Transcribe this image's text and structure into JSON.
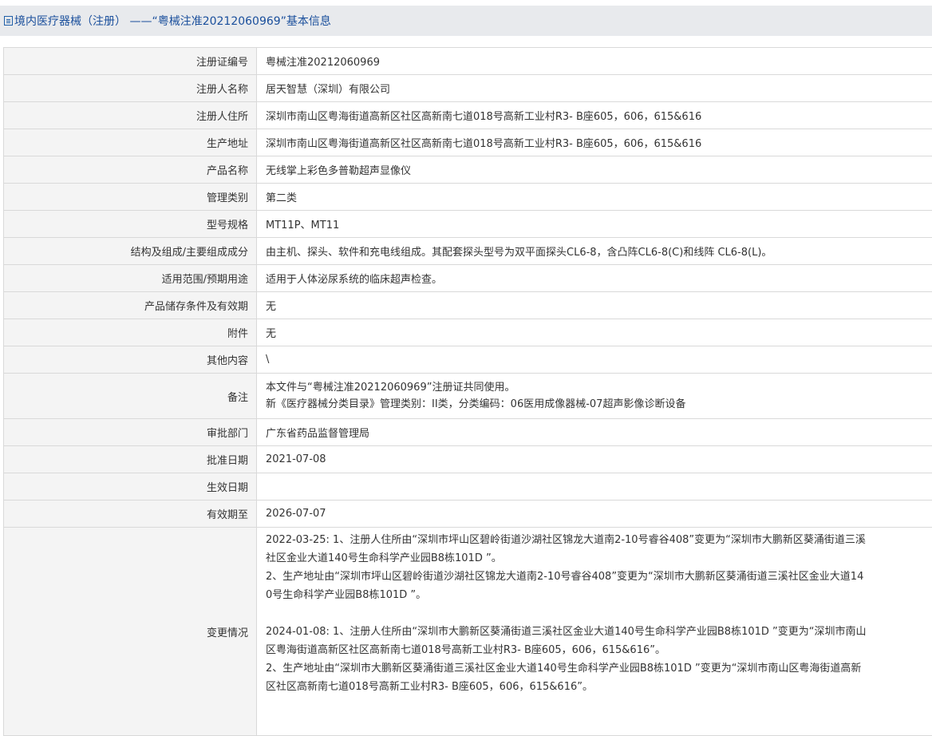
{
  "page": {
    "title": "境内医疗器械（注册） ——“粤械注准20212060969”基本信息"
  },
  "fields": [
    {
      "label": "注册证编号",
      "value": "粤械注准20212060969"
    },
    {
      "label": "注册人名称",
      "value": "居天智慧（深圳）有限公司"
    },
    {
      "label": "注册人住所",
      "value": "深圳市南山区粤海街道高新区社区高新南七道018号高新工业村R3- B座605，606，615&616"
    },
    {
      "label": "生产地址",
      "value": "深圳市南山区粤海街道高新区社区高新南七道018号高新工业村R3- B座605，606，615&616"
    },
    {
      "label": "产品名称",
      "value": "无线掌上彩色多普勒超声显像仪"
    },
    {
      "label": "管理类别",
      "value": "第二类"
    },
    {
      "label": "型号规格",
      "value": "MT11P、MT11"
    },
    {
      "label": "结构及组成/主要组成成分",
      "value": "由主机、探头、软件和充电线组成。其配套探头型号为双平面探头CL6-8，含凸阵CL6-8(C)和线阵 CL6-8(L)。"
    },
    {
      "label": "适用范围/预期用途",
      "value": "适用于人体泌尿系统的临床超声检查。"
    },
    {
      "label": "产品储存条件及有效期",
      "value": "无"
    },
    {
      "label": "附件",
      "value": "无"
    },
    {
      "label": "其他内容",
      "value": "\\"
    }
  ],
  "remarks": {
    "label": "备注",
    "line1": "本文件与“粤械注准20212060969”注册证共同使用。",
    "line2": "新《医疗器械分类目录》管理类别：II类，分类编码：06医用成像器械-07超声影像诊断设备"
  },
  "fields2": [
    {
      "label": "审批部门",
      "value": "广东省药品监督管理局"
    },
    {
      "label": "批准日期",
      "value": "2021-07-08"
    },
    {
      "label": "生效日期",
      "value": ""
    },
    {
      "label": "有效期至",
      "value": "2026-07-07"
    }
  ],
  "changes": {
    "label": "变更情况",
    "lines": [
      "2022-03-25: 1、注册人住所由“深圳市坪山区碧岭街道沙湖社区锦龙大道南2-10号睿谷408”变更为“深圳市大鹏新区葵涌街道三溪",
      "社区金业大道140号生命科学产业园B8栋101D ”。",
      "2、生产地址由“深圳市坪山区碧岭街道沙湖社区锦龙大道南2-10号睿谷408”变更为“深圳市大鹏新区葵涌街道三溪社区金业大道14",
      "0号生命科学产业园B8栋101D ”。",
      "",
      "2024-01-08: 1、注册人住所由“深圳市大鹏新区葵涌街道三溪社区金业大道140号生命科学产业园B8栋101D ”变更为“深圳市南山",
      "区粤海街道高新区社区高新南七道018号高新工业村R3- B座605，606，615&616”。",
      "2、生产地址由“深圳市大鹏新区葵涌街道三溪社区金业大道140号生命科学产业园B8栋101D ”变更为“深圳市南山区粤海街道高新",
      "区社区高新南七道018号高新工业村R3- B座605，606，615&616”。"
    ]
  }
}
